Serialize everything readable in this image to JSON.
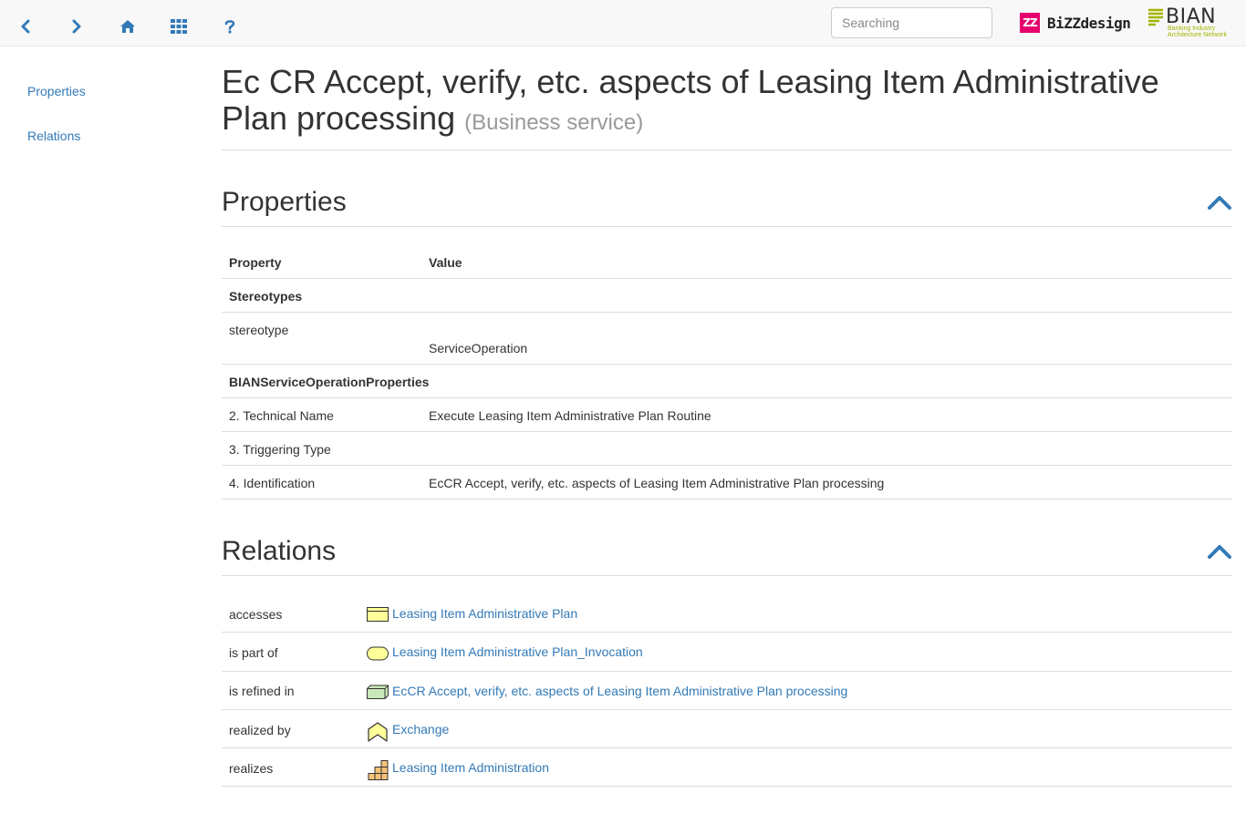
{
  "toolbar": {
    "search_placeholder": "Searching",
    "logos": {
      "bizzdesign_mark": "ZZ",
      "bizzdesign_text": "BiZZdesign",
      "bian_text": "BIAN",
      "bian_sub1": "Banking Industry",
      "bian_sub2": "Architecture Network"
    },
    "icons": [
      "chevron-left-icon",
      "chevron-right-icon",
      "home-icon",
      "grid-icon",
      "question-icon"
    ]
  },
  "sidebar": {
    "items": [
      {
        "label": "Properties"
      },
      {
        "label": "Relations"
      }
    ]
  },
  "header": {
    "title": "Ec CR Accept, verify, etc. aspects of Leasing Item Administrative Plan processing",
    "subtitle": "(Business service)"
  },
  "properties": {
    "heading": "Properties",
    "col_property": "Property",
    "col_value": "Value",
    "group_stereotypes": "Stereotypes",
    "stereotype_label": "stereotype",
    "stereotype_value": "ServiceOperation",
    "group_bian": "BIANServiceOperationProperties",
    "rows": [
      {
        "property": "2. Technical Name",
        "value": "Execute Leasing Item Administrative Plan Routine"
      },
      {
        "property": "3. Triggering Type",
        "value": ""
      },
      {
        "property": "4. Identification",
        "value": "EcCR Accept, verify, etc. aspects of Leasing Item Administrative Plan processing"
      }
    ]
  },
  "relations": {
    "heading": "Relations",
    "rows": [
      {
        "type": "accesses",
        "target": "Leasing Item Administrative Plan",
        "icon": "business-object-icon"
      },
      {
        "type": "is part of",
        "target": "Leasing Item Administrative Plan_Invocation",
        "icon": "business-service-icon"
      },
      {
        "type": "is refined in",
        "target": "EcCR Accept, verify, etc. aspects of Leasing Item Administrative Plan processing",
        "icon": "node-icon"
      },
      {
        "type": "realized by",
        "target": "Exchange",
        "icon": "value-stream-icon"
      },
      {
        "type": "realizes",
        "target": "Leasing Item Administration",
        "icon": "capability-icon"
      }
    ]
  },
  "colors": {
    "link": "#337ab7",
    "accent": "#337ab7",
    "bizzdesign": "#e5006e",
    "bian": "#a2b400"
  }
}
